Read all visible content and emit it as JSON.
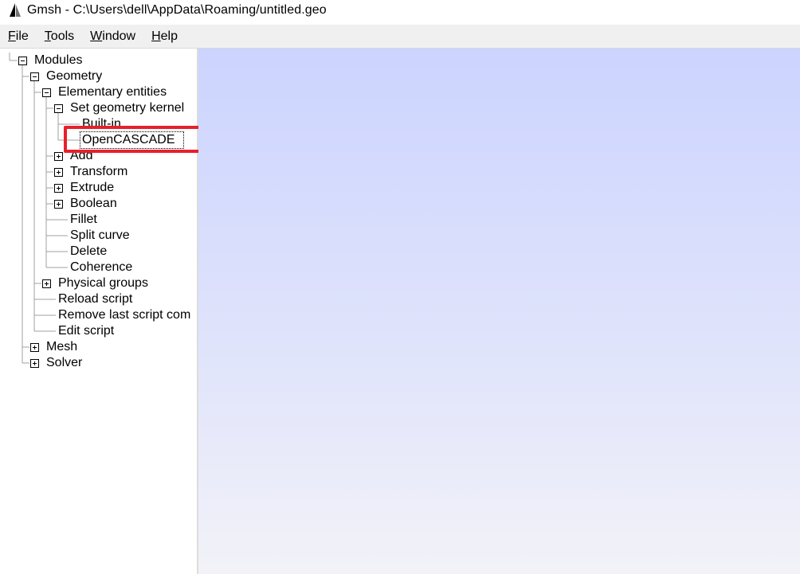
{
  "window": {
    "title": "Gmsh - C:\\Users\\dell\\AppData\\Roaming/untitled.geo",
    "icon": "gmsh-sail-icon"
  },
  "menu": {
    "file": {
      "acc": "F",
      "rest": "ile"
    },
    "tools": {
      "acc": "T",
      "rest": "ools"
    },
    "window": {
      "acc": "W",
      "rest": "indow"
    },
    "help": {
      "acc": "H",
      "rest": "elp"
    }
  },
  "tree": {
    "modules": "Modules",
    "geometry": "Geometry",
    "elementary": "Elementary entities",
    "set_kernel": "Set geometry kernel",
    "builtin": "Built-in",
    "occ": "OpenCASCADE",
    "add": "Add",
    "transform": "Transform",
    "extrude": "Extrude",
    "boolean": "Boolean",
    "fillet": "Fillet",
    "split_curve": "Split curve",
    "delete": "Delete",
    "coherence": "Coherence",
    "physical_groups": "Physical groups",
    "reload_script": "Reload script",
    "remove_last": "Remove last script com",
    "edit_script": "Edit script",
    "mesh": "Mesh",
    "solver": "Solver"
  },
  "colors": {
    "highlight": "#e8202a",
    "graphics_top": "#ccd4ff",
    "graphics_bottom": "#f2f2f8"
  }
}
